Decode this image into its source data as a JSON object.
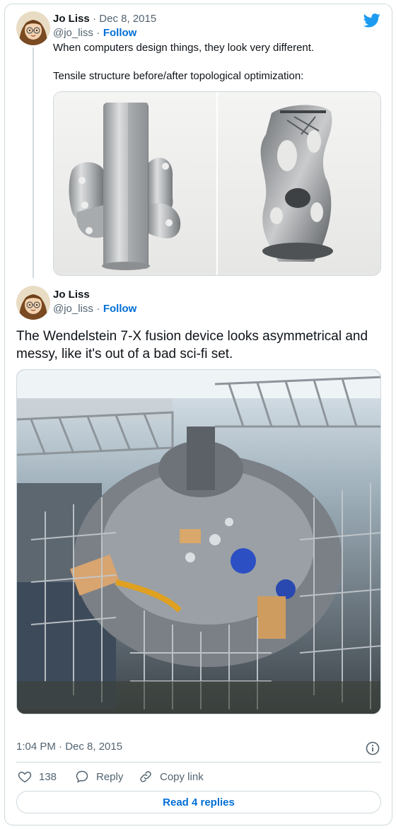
{
  "quoted_tweet": {
    "author_name": "Jo Liss",
    "date": "· Dec 8, 2015",
    "handle": "@jo_liss",
    "separator": "·",
    "follow_label": "Follow",
    "text_line1": "When computers design things, they look very different.",
    "text_line2": "Tensile structure before/after topological optimization:"
  },
  "main_tweet": {
    "author_name": "Jo Liss",
    "handle": "@jo_liss",
    "separator": "·",
    "follow_label": "Follow",
    "text": "The Wendelstein 7-X fusion device looks asymmetrical and messy, like it's out of a bad sci-fi set.",
    "timestamp": "1:04 PM · Dec 8, 2015"
  },
  "actions": {
    "like_count": "138",
    "reply_label": "Reply",
    "copy_link_label": "Copy link"
  },
  "read_replies_label": "Read 4 replies",
  "icons": {
    "brand": "twitter-bird-icon",
    "info": "info-icon",
    "like": "heart-icon",
    "reply": "speech-bubble-icon",
    "copy": "link-icon"
  },
  "colors": {
    "accent": "#006fd6",
    "brand": "#1d9bf0",
    "text": "#0f1419",
    "muted": "#536471",
    "border": "#cfd9de"
  }
}
